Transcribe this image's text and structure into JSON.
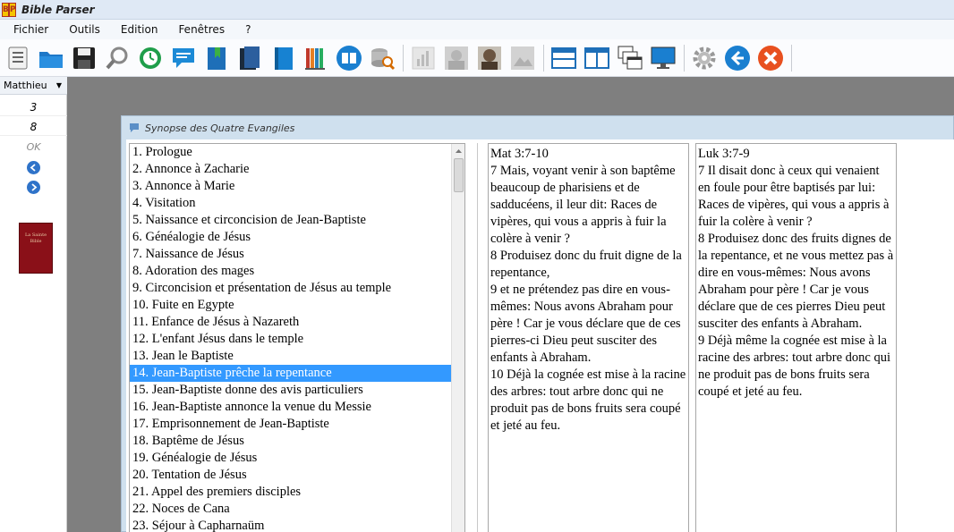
{
  "app": {
    "title": "Bible Parser"
  },
  "menu": [
    "Fichier",
    "Outils",
    "Edition",
    "Fenêtres",
    "?"
  ],
  "toolbar": {
    "icons": [
      "document-list-icon",
      "folder-open-icon",
      "save-icon",
      "search-icon",
      "refresh-clock-icon",
      "speech-bubble-icon",
      "bookmark-book-icon",
      "book-dark-icon",
      "book-blue-icon",
      "books-stack-icon",
      "open-book-icon",
      "search-database-icon",
      "bar-chart-icon",
      "image-icon",
      "portrait-icon",
      "image-gray-icon",
      "horizontal-split-icon",
      "vertical-split-icon",
      "cascade-windows-icon",
      "monitor-icon",
      "settings-gear-icon",
      "back-arrow-icon",
      "close-x-icon"
    ]
  },
  "left_panel": {
    "book": "Matthieu",
    "chapter": "3",
    "verse": "8",
    "ok_label": "OK",
    "cover_line1": "La Sainte",
    "cover_line2": "Bible"
  },
  "synopsis": {
    "title": "Synopse des Quatre Evangiles",
    "selected_index": 13,
    "items": [
      "1. Prologue",
      "2. Annonce à Zacharie",
      "3. Annonce à Marie",
      "4. Visitation",
      "5. Naissance et circoncision de Jean-Baptiste",
      "6. Généalogie de Jésus",
      "7. Naissance de Jésus",
      "8. Adoration des mages",
      "9. Circoncision et présentation de Jésus au temple",
      "10. Fuite en Egypte",
      "11. Enfance de Jésus à Nazareth",
      "12. L'enfant Jésus dans le temple",
      "13. Jean le Baptiste",
      "14. Jean-Baptiste prêche la repentance",
      "15. Jean-Baptiste donne des avis particuliers",
      "16. Jean-Baptiste annonce la venue du Messie",
      "17. Emprisonnement de Jean-Baptiste",
      "18. Baptême de Jésus",
      "19. Généalogie de Jésus",
      "20. Tentation de Jésus",
      "21. Appel des premiers disciples",
      "22. Noces de Cana",
      "23. Séjour à Capharnaüm"
    ],
    "col1": {
      "reference": "Mat 3:7-10",
      "verses": [
        "7 Mais, voyant venir à son baptême beaucoup de pharisiens et de sadducéens, il leur dit: Races de vipères, qui vous a appris à fuir la colère à venir ?",
        "8 Produisez donc du fruit digne de la repentance,",
        "9 et ne prétendez pas dire en vous-mêmes: Nous avons Abraham pour père ! Car je vous déclare que de ces pierres-ci Dieu peut susciter des enfants à Abraham.",
        "10  Déjà la cognée est mise à la racine des arbres: tout arbre donc qui ne produit pas de bons fruits sera coupé et jeté au feu."
      ]
    },
    "col2": {
      "reference": "Luk 3:7-9",
      "verses": [
        "7 Il disait donc à ceux qui venaient en foule pour être baptisés par lui: Races de vipères, qui vous a appris à fuir la colère à venir ?",
        "8 Produisez donc des fruits dignes de la repentance, et ne vous mettez pas à dire en vous-mêmes: Nous avons Abraham pour père ! Car je vous déclare que de ces pierres Dieu peut susciter des enfants à Abraham.",
        "9  Déjà même la cognée est mise à la racine des arbres: tout arbre donc qui ne produit pas de bons fruits sera coupé et jeté au feu."
      ]
    }
  }
}
